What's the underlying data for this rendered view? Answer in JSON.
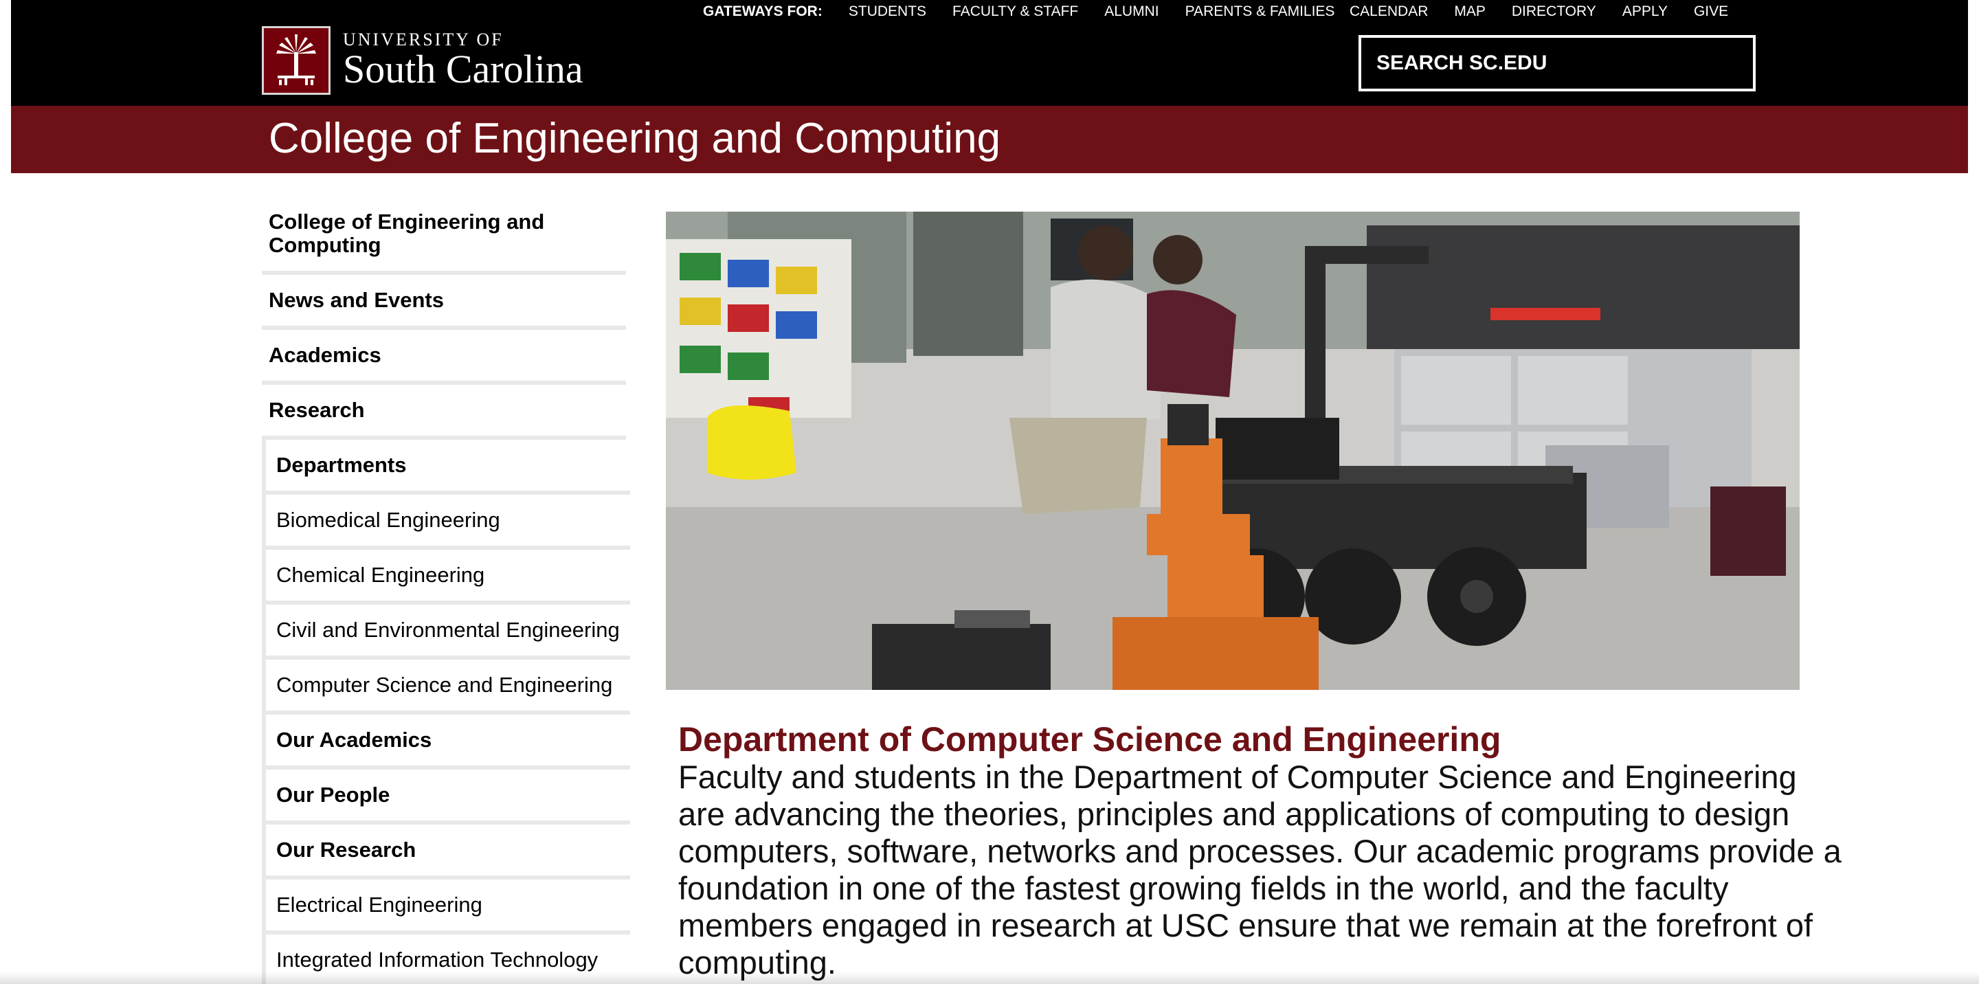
{
  "header": {
    "logo": {
      "top_line": "UNIVERSITY OF",
      "main_line": "South Carolina"
    },
    "gateways": {
      "label": "GATEWAYS FOR:",
      "links": [
        "STUDENTS",
        "FACULTY & STAFF",
        "ALUMNI",
        "PARENTS & FAMILIES"
      ]
    },
    "utility_links": [
      "CALENDAR",
      "MAP",
      "DIRECTORY",
      "APPLY",
      "GIVE"
    ],
    "search": {
      "placeholder": "SEARCH SC.EDU"
    }
  },
  "college_title": "College of Engineering and Computing",
  "sidebar": {
    "top_items": [
      "College of Engineering and Computing",
      "News and Events",
      "Academics",
      "Research"
    ],
    "sub_items": [
      {
        "label": "Departments",
        "bold": true
      },
      {
        "label": "Biomedical Engineering",
        "bold": false
      },
      {
        "label": "Chemical Engineering",
        "bold": false
      },
      {
        "label": "Civil and Environmental Engineering",
        "bold": false
      },
      {
        "label": "Computer Science and Engineering",
        "bold": false
      },
      {
        "label": "Our Academics",
        "bold": true
      },
      {
        "label": "Our People",
        "bold": true
      },
      {
        "label": "Our Research",
        "bold": true
      },
      {
        "label": "Electrical Engineering",
        "bold": false
      },
      {
        "label": "Integrated Information Technology",
        "bold": false
      }
    ]
  },
  "main": {
    "heading": "Department of Computer Science and Engineering",
    "body": "Faculty and students in the Department of Computer Science and Engineering are advancing the theories, principles and applications of computing to design computers, software, networks and processes. Our academic programs provide a foundation in one of the fastest growing fields in the world, and the faculty members engaged in research at USC ensure that we remain at the forefront of computing."
  },
  "colors": {
    "garnet": "#6e1116",
    "black": "#000000",
    "divider": "#e8e8e8"
  }
}
